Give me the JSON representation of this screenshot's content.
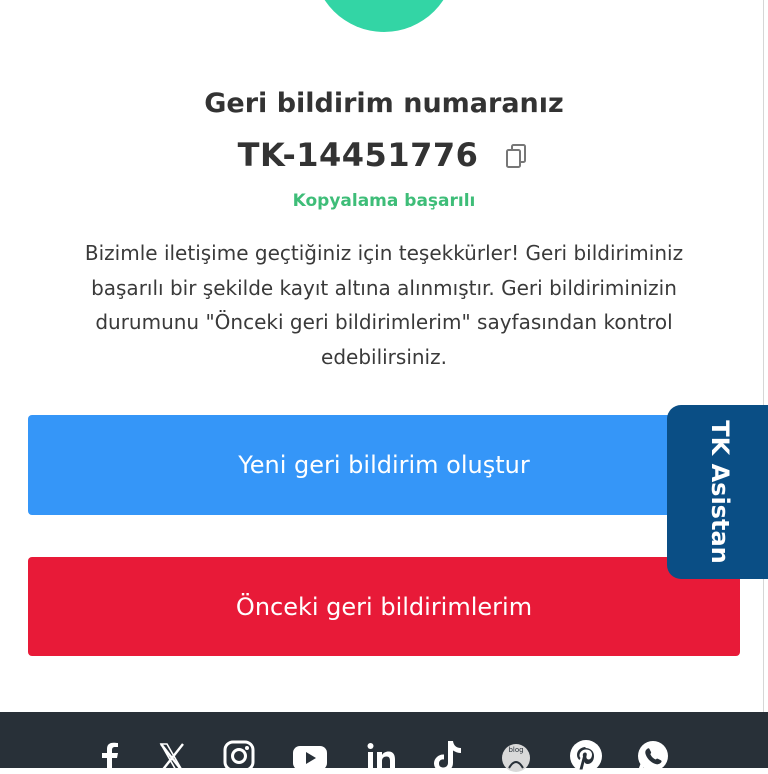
{
  "feedback": {
    "title": "Geri bildirim numaranız",
    "code": "TK-14451776",
    "copy_status": "Kopyalama başarılı",
    "message": "Bizimle iletişime geçtiğiniz için teşekkürler! Geri bildiriminiz başarılı bir şekilde kayıt altına alınmıştır. Geri bildiriminizin durumunu \"Önceki geri bildirimlerim\" sayfasından kontrol edebilirsiniz."
  },
  "buttons": {
    "new_feedback": "Yeni geri bildirim oluştur",
    "previous_feedback": "Önceki geri bildirimlerim"
  },
  "assistant": {
    "label": "TK Asistan"
  },
  "colors": {
    "success": "#33d5a5",
    "primary_blue": "#3596f8",
    "primary_red": "#e81a38",
    "assistant_navy": "#0a4e85",
    "footer_bg": "#283038",
    "status_green": "#3ebd78"
  },
  "footer": {
    "social_icons": [
      "facebook-icon",
      "x-icon",
      "instagram-icon",
      "youtube-icon",
      "linkedin-icon",
      "tiktok-icon",
      "blog-icon",
      "pinterest-icon",
      "whatsapp-icon"
    ]
  }
}
